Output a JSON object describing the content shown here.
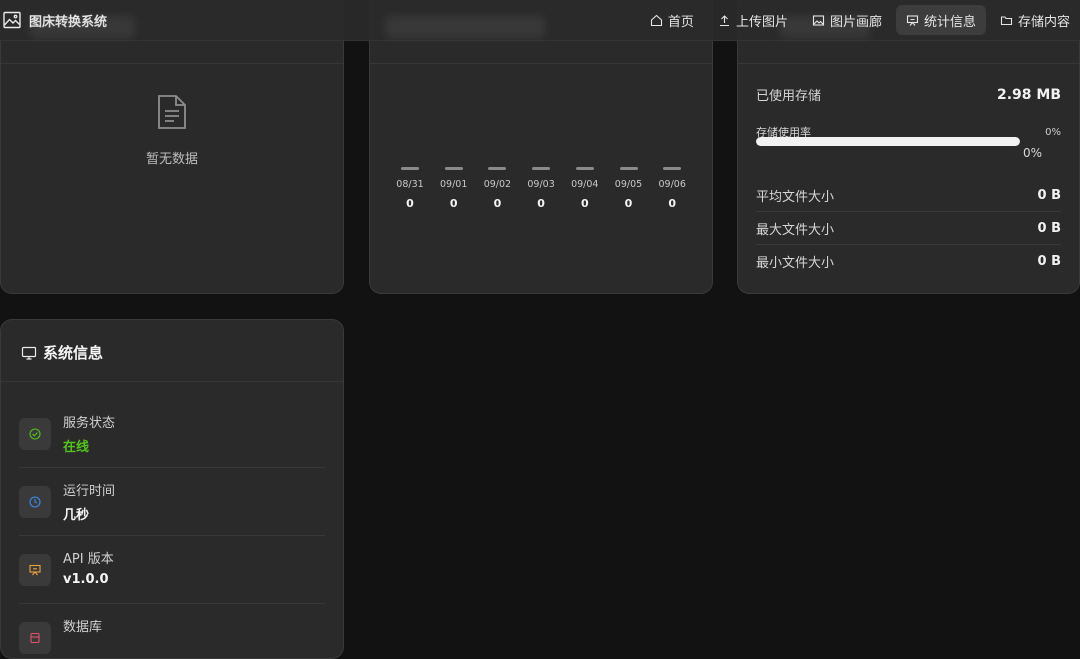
{
  "app": {
    "title": "图床转换系统"
  },
  "nav": {
    "items": [
      {
        "label": "首页",
        "icon": "home-icon",
        "active": false
      },
      {
        "label": "上传图片",
        "icon": "upload-icon",
        "active": false
      },
      {
        "label": "图片画廊",
        "icon": "gallery-icon",
        "active": false
      },
      {
        "label": "统计信息",
        "icon": "stats-icon",
        "active": true
      },
      {
        "label": "存储内容",
        "icon": "folder-icon",
        "active": false
      }
    ]
  },
  "type_card": {
    "empty_text": "暂无数据"
  },
  "trend_card": {
    "days": [
      {
        "date": "08/31",
        "count": "0"
      },
      {
        "date": "09/01",
        "count": "0"
      },
      {
        "date": "09/02",
        "count": "0"
      },
      {
        "date": "09/03",
        "count": "0"
      },
      {
        "date": "09/04",
        "count": "0"
      },
      {
        "date": "09/05",
        "count": "0"
      },
      {
        "date": "09/06",
        "count": "0"
      }
    ]
  },
  "storage_card": {
    "used_label": "已使用存储",
    "used_value": "2.98 MB",
    "usage_label": "存储使用率",
    "usage_percent_text": "0%",
    "usage_fraction": 0.0,
    "avg_label": "平均文件大小",
    "avg_value": "0 B",
    "max_label": "最大文件大小",
    "max_value": "0 B",
    "min_label": "最小文件大小",
    "min_value": "0 B"
  },
  "system_card": {
    "title": "系统信息",
    "items": [
      {
        "label": "服务状态",
        "value": "在线",
        "icon": "check-circle-icon",
        "color": "#52c41a"
      },
      {
        "label": "运行时间",
        "value": "几秒",
        "icon": "clock-icon",
        "color": "#3b8ee8"
      },
      {
        "label": "API 版本",
        "value": "v1.0.0",
        "icon": "api-icon",
        "color": "#e8a33b"
      },
      {
        "label": "数据库",
        "value": "",
        "icon": "database-icon",
        "color": "#e0556a"
      }
    ]
  },
  "colors": {
    "online": "#52c41a",
    "accent_active": "#3d3d3d"
  }
}
